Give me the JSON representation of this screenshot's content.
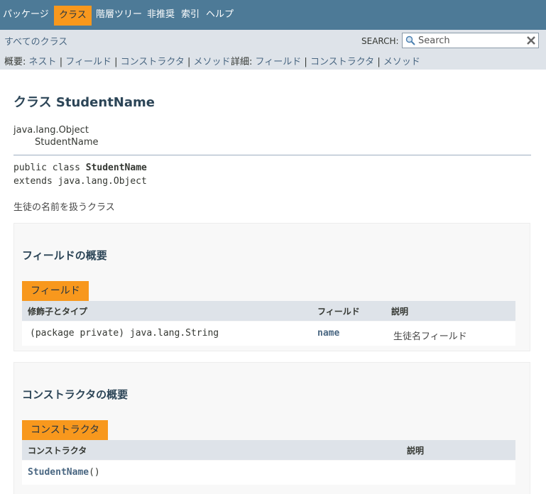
{
  "topnav": {
    "items": [
      {
        "label": "パッケージ",
        "active": false
      },
      {
        "label": "クラス",
        "active": true
      },
      {
        "label": "階層ツリー",
        "active": false
      },
      {
        "label": "非推奨",
        "active": false
      },
      {
        "label": "索引",
        "active": false
      },
      {
        "label": "ヘルプ",
        "active": false
      }
    ]
  },
  "subnav": {
    "all_classes": "すべてのクラス",
    "search_label": "SEARCH:",
    "search_placeholder": "Search",
    "summary_label": "概要:",
    "summary_links": [
      "ネスト",
      "フィールド",
      "コンストラクタ",
      "メソッド"
    ],
    "detail_label": "詳細:",
    "detail_links": [
      "フィールド",
      "コンストラクタ",
      "メソッド"
    ],
    "separator": "|"
  },
  "class_header": {
    "title": "クラス StudentName",
    "inheritance": [
      "java.lang.Object",
      "StudentName"
    ]
  },
  "signature": {
    "prefix": "public class ",
    "name": "StudentName",
    "extends": "extends java.lang.Object"
  },
  "class_description": "生徒の名前を扱うクラス",
  "field_summary": {
    "heading": "フィールドの概要",
    "tab": "フィールド",
    "columns": [
      "修飾子とタイプ",
      "フィールド",
      "説明"
    ],
    "rows": [
      {
        "modifier_type": "(package private) java.lang.String",
        "field": "name",
        "description": "生徒名フィールド"
      }
    ]
  },
  "constructor_summary": {
    "heading": "コンストラクタの概要",
    "tab": "コンストラクタ",
    "columns": [
      "コンストラクタ",
      "説明"
    ],
    "rows": [
      {
        "name": "StudentName",
        "params": "()"
      }
    ]
  },
  "colors": {
    "nav_bg": "#4d7a97",
    "subnav_bg": "#dee3e9",
    "accent": "#f8981d",
    "link": "#4a6782"
  }
}
